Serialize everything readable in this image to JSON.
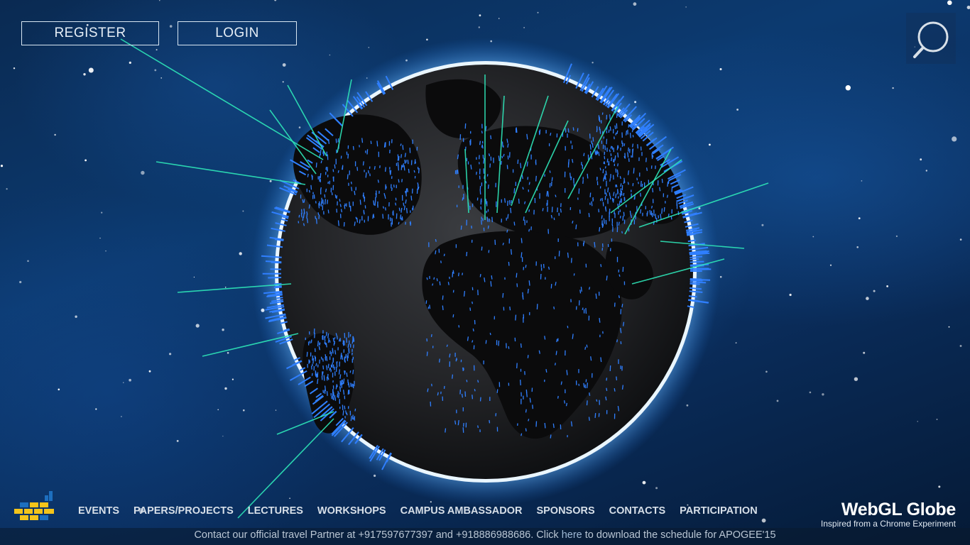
{
  "header": {
    "register_label": "REGISTER",
    "login_label": "LOGIN",
    "search_icon": "search-icon"
  },
  "nav": {
    "logo_icon": "apogee-logo-icon",
    "items": [
      {
        "label": "EVENTS"
      },
      {
        "label": "PAPERS/PROJECTS"
      },
      {
        "label": "LECTURES"
      },
      {
        "label": "WORKSHOPS"
      },
      {
        "label": "CAMPUS AMBASSADOR"
      },
      {
        "label": "SPONSORS"
      },
      {
        "label": "CONTACTS"
      },
      {
        "label": "PARTICIPATION"
      }
    ]
  },
  "credit": {
    "title": "WebGL Globe",
    "subtitle": "Inspired from a Chrome Experiment"
  },
  "footer": {
    "text_before": "Contact our official travel Partner at +917597677397 and +918886988686. Click ",
    "link_text": "here",
    "text_after": " to download the schedule for APOGEE'15"
  },
  "colors": {
    "spike_teal": "#2ee6b8",
    "spike_blue": "#2f7fff",
    "globe_rim": "#eaf6ff",
    "logo_yellow": "#f4c41a",
    "logo_blue": "#1d6fbf"
  }
}
